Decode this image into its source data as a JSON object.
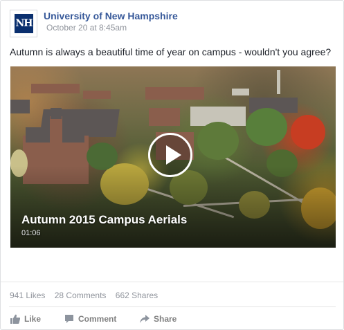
{
  "post": {
    "page_name": "University of New Hampshire",
    "timestamp": "October 20 at 8:45am",
    "avatar_text": "NH",
    "text": "Autumn is always a beautiful time of year on campus - wouldn't you agree?",
    "video": {
      "title": "Autumn 2015 Campus Aerials",
      "duration": "01:06"
    }
  },
  "stats": {
    "likes": "941 Likes",
    "comments": "28 Comments",
    "shares": "662 Shares"
  },
  "actions": {
    "like_label": "Like",
    "comment_label": "Comment",
    "share_label": "Share"
  },
  "icons": {
    "like": "thumbs-up-icon",
    "comment": "speech-bubble-icon",
    "share": "share-arrow-icon",
    "play": "play-icon"
  },
  "colors": {
    "link": "#365899",
    "meta": "#90949c",
    "text": "#1d2129",
    "action": "#7f7f7f",
    "avatar_bg": "#0a2f6e"
  }
}
